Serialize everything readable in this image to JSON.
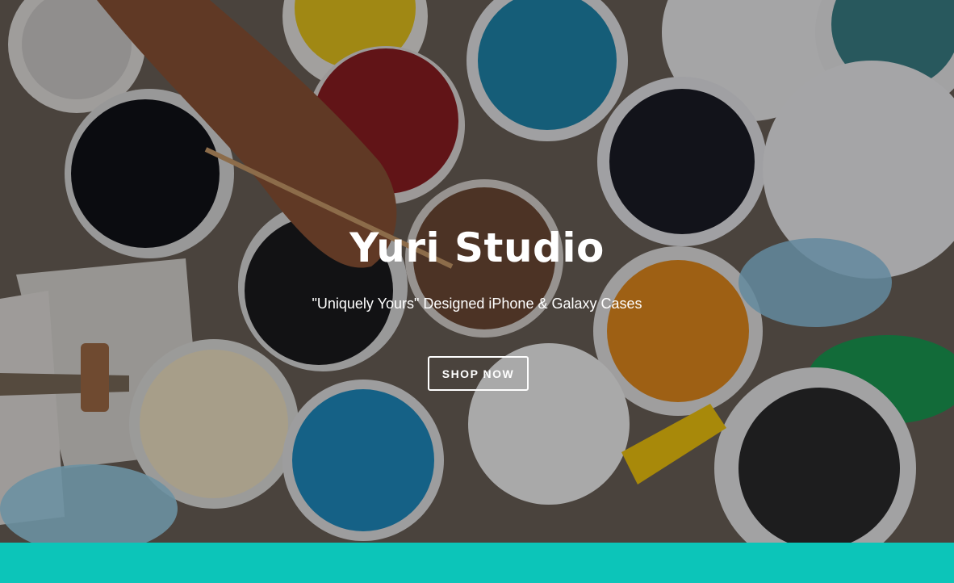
{
  "hero": {
    "title": "Yuri Studio",
    "subtitle": "\"Uniquely Yours\" Designed iPhone & Galaxy Cases",
    "cta_label": "SHOP NOW",
    "background_image": "overhead view of open paint buckets with a hand holding a paintbrush"
  },
  "colors": {
    "accent_band": "#0cc5b9",
    "text": "#ffffff"
  }
}
